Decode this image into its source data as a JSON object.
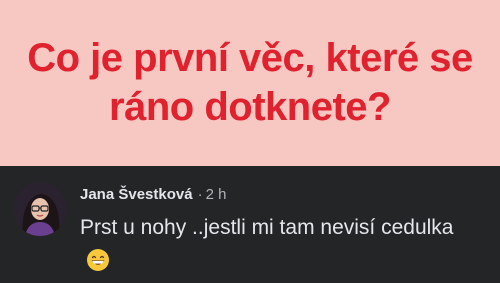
{
  "post": {
    "headline": "Co je první věc, které se ráno dotknete?",
    "text_color": "#e0212e",
    "background_color": "#f7c7c2"
  },
  "comment": {
    "author": "Jana Švestková",
    "separator": "·",
    "time": "2 h",
    "text": "Prst u nohy ..jestli mi tam nevisí cedulka",
    "emoji": "grinning-face-with-smiling-eyes-icon",
    "background_color": "#242526"
  }
}
